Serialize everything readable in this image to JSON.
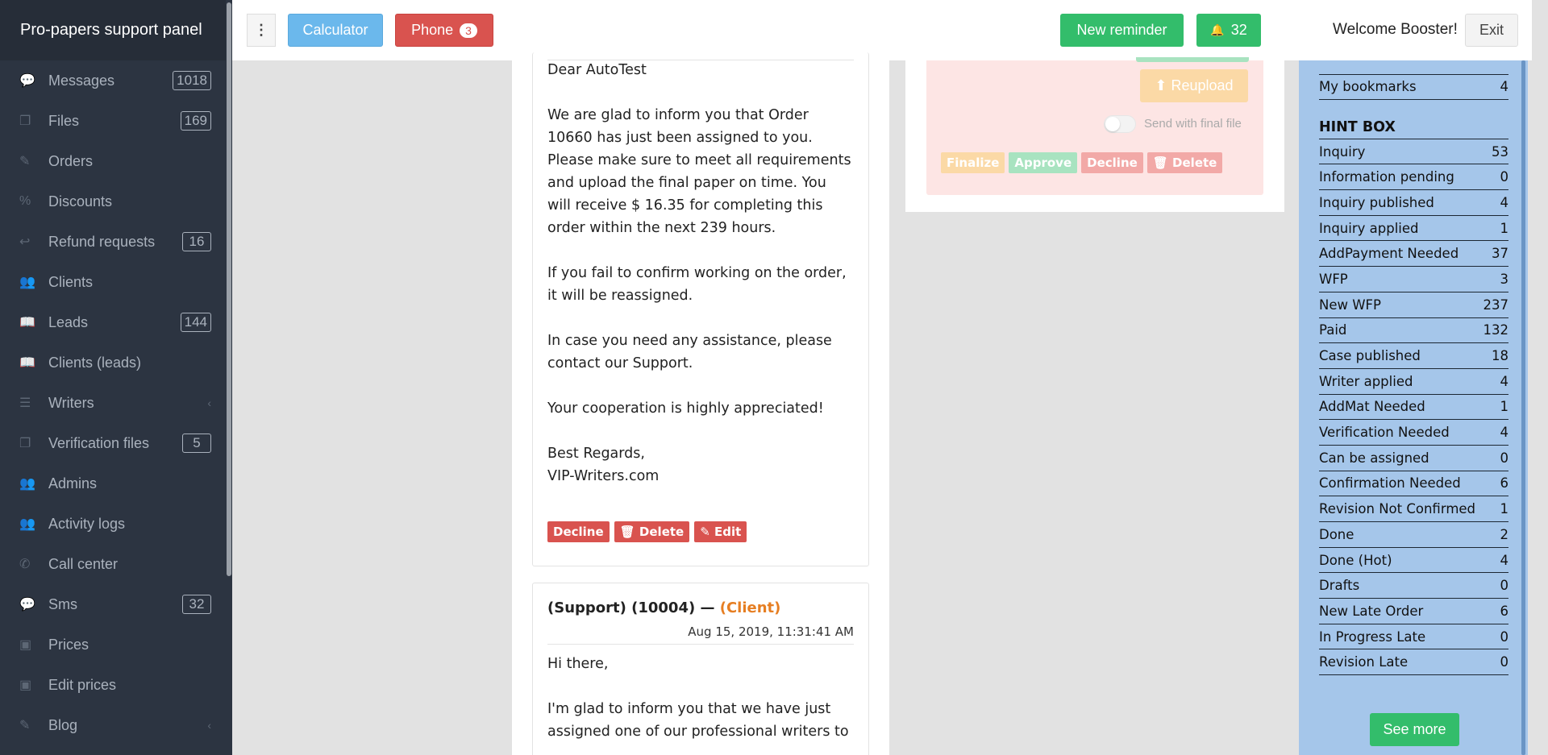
{
  "sidebar": {
    "brand": "Pro-papers support panel",
    "items": [
      {
        "label": "Messages",
        "icon": "chat-icon",
        "glyph": "💬",
        "badge": "1018"
      },
      {
        "label": "Files",
        "icon": "files-icon",
        "glyph": "❐",
        "badge": "169"
      },
      {
        "label": "Orders",
        "icon": "edit-icon",
        "glyph": "✎",
        "badge": ""
      },
      {
        "label": "Discounts",
        "icon": "percent-icon",
        "glyph": "%",
        "badge": ""
      },
      {
        "label": "Refund requests",
        "icon": "reply-icon",
        "glyph": "↩",
        "badge": "16"
      },
      {
        "label": "Clients",
        "icon": "users-icon",
        "glyph": "👥",
        "badge": ""
      },
      {
        "label": "Leads",
        "icon": "book-icon",
        "glyph": "📖",
        "badge": "144"
      },
      {
        "label": "Clients (leads)",
        "icon": "book-icon",
        "glyph": "📖",
        "badge": ""
      },
      {
        "label": "Writers",
        "icon": "list-icon",
        "glyph": "☰",
        "badge": "",
        "chevron": "‹"
      },
      {
        "label": "Verification files",
        "icon": "files-icon",
        "glyph": "❐",
        "badge": "5"
      },
      {
        "label": "Admins",
        "icon": "users-icon",
        "glyph": "👥",
        "badge": ""
      },
      {
        "label": "Activity logs",
        "icon": "users-icon",
        "glyph": "👥",
        "badge": ""
      },
      {
        "label": "Call center",
        "icon": "phone-icon",
        "glyph": "✆",
        "badge": ""
      },
      {
        "label": "Sms",
        "icon": "chat-icon",
        "glyph": "💬",
        "badge": "32"
      },
      {
        "label": "Prices",
        "icon": "money-icon",
        "glyph": "▣",
        "badge": ""
      },
      {
        "label": "Edit prices",
        "icon": "money-icon",
        "glyph": "▣",
        "badge": ""
      },
      {
        "label": "Blog",
        "icon": "pencil-icon",
        "glyph": "✎",
        "badge": "",
        "chevron": "‹"
      }
    ]
  },
  "topbar": {
    "more_glyph": "⋮",
    "calculator": "Calculator",
    "phone": "Phone",
    "phone_count": "3",
    "new_reminder": "New reminder",
    "bell_glyph": "🔔",
    "notifications": "32",
    "welcome": "Welcome Booster!",
    "exit": "Exit"
  },
  "messages": {
    "first": {
      "paragraphs": [
        "Dear AutoTest",
        "We are glad to inform you that Order 10660 has just been assigned to you. Please make sure to meet all requirements and upload the final paper on time. You will receive $ 16.35 for completing this order within the next 239 hours.",
        "If you fail to confirm working on the order, it will be reassigned.",
        "In case you need any assistance, please contact our Support.",
        "Your cooperation is highly appreciated!",
        "Best Regards,\nVIP-Writers.com"
      ],
      "decline": "Decline",
      "delete": "🗑 Delete",
      "edit": "✎ Edit"
    },
    "second": {
      "author": "(Support) (10004) —",
      "role": "(Client)",
      "date": "Aug 15, 2019, 11:31:41 AM",
      "greeting": "Hi there,",
      "body": "I'm glad to inform you that we have just assigned one of our professional writers to"
    }
  },
  "order_panel": {
    "reupload": "⬆ Reupload",
    "send_with_final": "Send with final file",
    "finalize": "Finalize",
    "approve": "Approve",
    "decline": "Decline",
    "delete": "🗑 Delete"
  },
  "hint": {
    "bookmarks_label": "My bookmarks",
    "bookmarks_count": "4",
    "title": "HINT BOX",
    "rows": [
      {
        "label": "Inquiry",
        "count": "53"
      },
      {
        "label": "Information pending",
        "count": "0"
      },
      {
        "label": "Inquiry published",
        "count": "4"
      },
      {
        "label": "Inquiry applied",
        "count": "1"
      },
      {
        "label": "AddPayment Needed",
        "count": "37"
      },
      {
        "label": "WFP",
        "count": "3"
      },
      {
        "label": "New WFP",
        "count": "237"
      },
      {
        "label": "Paid",
        "count": "132"
      },
      {
        "label": "Case published",
        "count": "18"
      },
      {
        "label": "Writer applied",
        "count": "4"
      },
      {
        "label": "AddMat Needed",
        "count": "1"
      },
      {
        "label": "Verification Needed",
        "count": "4"
      },
      {
        "label": "Can be assigned",
        "count": "0"
      },
      {
        "label": "Confirmation Needed",
        "count": "6"
      },
      {
        "label": "Revision Not Confirmed",
        "count": "1"
      },
      {
        "label": "Done",
        "count": "2"
      },
      {
        "label": "Done (Hot)",
        "count": "4"
      },
      {
        "label": "Drafts",
        "count": "0"
      },
      {
        "label": "New Late Order",
        "count": "6"
      },
      {
        "label": "In Progress Late",
        "count": "0"
      },
      {
        "label": "Revision Late",
        "count": "0"
      }
    ],
    "see_more": "See more"
  },
  "colors": {
    "sidebar_bg": "#2c3441",
    "primary_blue": "#6bb8ec",
    "danger": "#d9534f",
    "success": "#33bd6b",
    "hint_bg": "#a5c6ea",
    "client_orange": "#e67e22"
  }
}
